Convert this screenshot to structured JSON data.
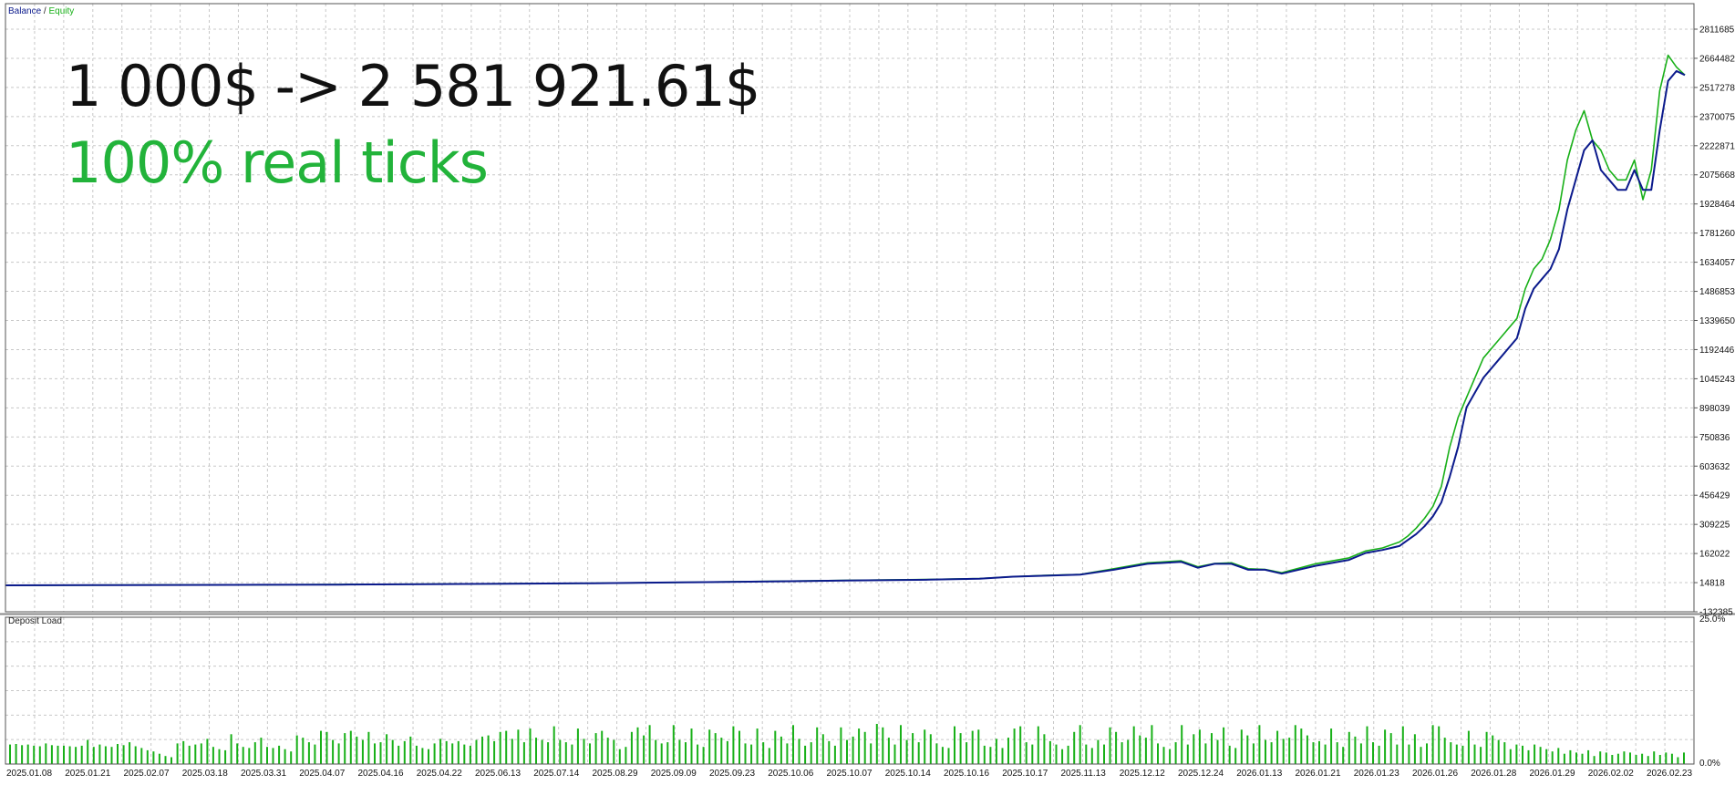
{
  "overlay": {
    "headline": "1 000$ -> 2 581 921.61$",
    "subline": "100% real ticks",
    "subline_color": "#22b33a"
  },
  "legend": {
    "balance_label": "Balance",
    "separator": "/",
    "equity_label": "Equity"
  },
  "colors": {
    "balance": "#0b1a8c",
    "equity": "#18b018",
    "deposit_load": "#18b018",
    "grid": "#c8c8c8",
    "axis_text": "#111111",
    "frame": "#555555"
  },
  "chart_data": [
    {
      "type": "line",
      "y_ticks": [
        "2811685",
        "2664482",
        "2517278",
        "2370075",
        "2222871",
        "2075668",
        "1928464",
        "1781260",
        "1634057",
        "1486853",
        "1339650",
        "1192446",
        "1045243",
        "898039",
        "750836",
        "603632",
        "456429",
        "309225",
        "162022",
        "14818",
        "-132385"
      ],
      "ylim": [
        -132385,
        2811685
      ],
      "x_ticks": [
        "2025.01.08",
        "2025.01.21",
        "2025.02.07",
        "2025.03.18",
        "2025.03.31",
        "2025.04.07",
        "2025.04.16",
        "2025.04.22",
        "2025.06.13",
        "2025.07.14",
        "2025.08.29",
        "2025.09.09",
        "2025.09.23",
        "2025.10.06",
        "2025.10.07",
        "2025.10.14",
        "2025.10.16",
        "2025.10.17",
        "2025.11.13",
        "2025.12.12",
        "2025.12.24",
        "2026.01.13",
        "2026.01.21",
        "2026.01.23",
        "2026.01.26",
        "2026.01.28",
        "2026.01.29",
        "2026.02.02",
        "2026.02.23"
      ],
      "series": [
        {
          "name": "Balance",
          "x": [
            0,
            0.05,
            0.1,
            0.15,
            0.2,
            0.25,
            0.3,
            0.35,
            0.4,
            0.45,
            0.5,
            0.55,
            0.58,
            0.6,
            0.62,
            0.64,
            0.66,
            0.68,
            0.7,
            0.71,
            0.72,
            0.73,
            0.74,
            0.75,
            0.76,
            0.78,
            0.8,
            0.81,
            0.82,
            0.83,
            0.835,
            0.84,
            0.845,
            0.85,
            0.855,
            0.86,
            0.865,
            0.87,
            0.88,
            0.89,
            0.9,
            0.905,
            0.91,
            0.915,
            0.92,
            0.925,
            0.93,
            0.935,
            0.94,
            0.945,
            0.95,
            0.955,
            0.96,
            0.965,
            0.97,
            0.975,
            0.98,
            0.985,
            0.99,
            0.995,
            1.0
          ],
          "values": [
            1000,
            2000,
            3000,
            4000,
            5000,
            7000,
            9000,
            12000,
            16000,
            20000,
            25000,
            30000,
            35000,
            45000,
            50000,
            55000,
            80000,
            110000,
            120000,
            90000,
            110000,
            110000,
            80000,
            80000,
            60000,
            100000,
            130000,
            165000,
            180000,
            200000,
            230000,
            260000,
            300000,
            350000,
            420000,
            550000,
            700000,
            900000,
            1050000,
            1150000,
            1250000,
            1400000,
            1500000,
            1550000,
            1600000,
            1700000,
            1900000,
            2050000,
            2200000,
            2250000,
            2100000,
            2050000,
            2000000,
            2000000,
            2100000,
            2000000,
            2000000,
            2300000,
            2550000,
            2600000,
            2580000
          ]
        },
        {
          "name": "Equity",
          "x": [
            0,
            0.05,
            0.1,
            0.15,
            0.2,
            0.25,
            0.3,
            0.35,
            0.4,
            0.45,
            0.5,
            0.55,
            0.58,
            0.6,
            0.62,
            0.64,
            0.66,
            0.68,
            0.7,
            0.71,
            0.72,
            0.73,
            0.74,
            0.75,
            0.76,
            0.78,
            0.8,
            0.81,
            0.82,
            0.83,
            0.835,
            0.84,
            0.845,
            0.85,
            0.855,
            0.86,
            0.865,
            0.87,
            0.88,
            0.89,
            0.9,
            0.905,
            0.91,
            0.915,
            0.92,
            0.925,
            0.93,
            0.935,
            0.94,
            0.945,
            0.95,
            0.955,
            0.96,
            0.965,
            0.97,
            0.975,
            0.98,
            0.985,
            0.99,
            0.995,
            1.0
          ],
          "values": [
            1000,
            2000,
            3500,
            4000,
            6000,
            7000,
            9500,
            12000,
            16000,
            21000,
            26000,
            31000,
            36000,
            45000,
            52000,
            56000,
            85000,
            115000,
            125000,
            95000,
            112000,
            115000,
            85000,
            82000,
            65000,
            110000,
            140000,
            175000,
            190000,
            220000,
            250000,
            290000,
            340000,
            400000,
            500000,
            700000,
            850000,
            950000,
            1150000,
            1250000,
            1350000,
            1500000,
            1600000,
            1650000,
            1750000,
            1900000,
            2150000,
            2300000,
            2400000,
            2250000,
            2200000,
            2100000,
            2050000,
            2050000,
            2150000,
            1950000,
            2100000,
            2500000,
            2680000,
            2620000,
            2580000
          ]
        }
      ]
    },
    {
      "type": "bar",
      "title": "Deposit Load",
      "y_ticks": [
        "25.0%",
        "0.0%"
      ],
      "ylim": [
        0,
        25
      ],
      "values": [
        3.4,
        3.5,
        3.3,
        3.4,
        3.2,
        3.1,
        3.6,
        3.3,
        3.2,
        3.2,
        3.1,
        3.0,
        3.2,
        4.2,
        3.0,
        3.4,
        3.1,
        3.0,
        3.5,
        3.3,
        3.8,
        3.1,
        2.8,
        2.4,
        2.2,
        1.8,
        1.4,
        1.2,
        3.6,
        4.0,
        3.2,
        3.4,
        3.6,
        4.4,
        3.0,
        2.6,
        2.4,
        5.2,
        3.6,
        3.0,
        2.8,
        3.8,
        4.6,
        3.0,
        2.8,
        3.2,
        2.6,
        2.2,
        5.0,
        4.6,
        3.8,
        3.4,
        5.8,
        5.6,
        4.2,
        3.6,
        5.4,
        5.8,
        4.8,
        4.2,
        5.6,
        3.6,
        3.8,
        5.2,
        4.2,
        3.2,
        4.0,
        4.8,
        3.2,
        2.8,
        2.6,
        3.6,
        4.4,
        4.0,
        3.6,
        4.0,
        3.4,
        3.2,
        4.2,
        4.8,
        5.0,
        4.0,
        5.6,
        5.8,
        4.4,
        6.0,
        3.8,
        6.2,
        4.6,
        4.2,
        3.8,
        6.6,
        4.2,
        3.8,
        3.4,
        6.2,
        4.4,
        3.6,
        5.4,
        5.8,
        4.6,
        4.2,
        2.6,
        3.0,
        5.6,
        6.4,
        5.0,
        6.8,
        4.2,
        3.6,
        3.8,
        6.8,
        4.2,
        3.8,
        6.2,
        3.4,
        3.0,
        6.0,
        5.4,
        4.6,
        4.0,
        6.6,
        5.8,
        3.6,
        3.4,
        6.2,
        3.8,
        2.8,
        5.8,
        4.8,
        3.6,
        6.8,
        4.4,
        3.2,
        3.8,
        6.4,
        5.2,
        4.0,
        3.2,
        6.4,
        4.2,
        4.8,
        6.2,
        5.6,
        3.6,
        7.0,
        6.4,
        4.6,
        3.4,
        6.8,
        4.2,
        5.4,
        3.8,
        6.0,
        5.2,
        3.6,
        3.0,
        2.8,
        6.6,
        5.4,
        3.8,
        5.8,
        6.0,
        3.2,
        3.0,
        4.4,
        2.8,
        4.6,
        6.2,
        6.6,
        3.8,
        3.4,
        6.6,
        5.2,
        4.0,
        3.4,
        2.6,
        3.2,
        5.6,
        6.8,
        3.4,
        2.8,
        4.2,
        3.4,
        6.4,
        5.6,
        3.8,
        4.2,
        6.6,
        5.0,
        4.6,
        6.8,
        3.6,
        3.0,
        2.6,
        3.8,
        6.8,
        3.4,
        5.2,
        6.0,
        3.6,
        5.4,
        4.2,
        6.4,
        3.2,
        2.8,
        6.0,
        5.0,
        3.6,
        6.8,
        4.2,
        3.8,
        5.8,
        4.4,
        4.6,
        6.8,
        6.2,
        5.0,
        3.8,
        4.0,
        3.4,
        6.2,
        3.8,
        3.0,
        5.6,
        4.8,
        3.6,
        6.6,
        3.8,
        3.2,
        6.0,
        5.4,
        3.4,
        6.6,
        3.4,
        5.2,
        3.0,
        3.6,
        6.8,
        6.6,
        4.6,
        3.8,
        3.4,
        3.2,
        5.8,
        3.4,
        3.0,
        5.6,
        5.0,
        4.2,
        3.8,
        2.6,
        3.4,
        3.2,
        2.4,
        3.4,
        3.0,
        2.6,
        2.2,
        2.8,
        1.8,
        2.4,
        2.0,
        1.8,
        2.4,
        1.4,
        2.2,
        2.0,
        1.6,
        1.8,
        2.2,
        2.0,
        1.6,
        1.8,
        1.4,
        2.2,
        1.6,
        2.0,
        1.8,
        1.2,
        2.0
      ]
    }
  ]
}
